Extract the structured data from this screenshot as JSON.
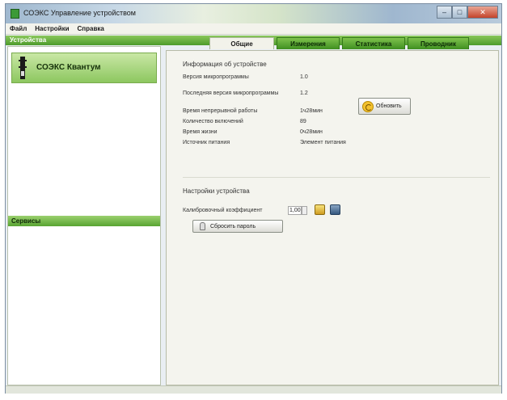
{
  "window": {
    "title": "СОЭКС Управление устройством",
    "controls": {
      "minimize": "–",
      "maximize": "□",
      "close": "✕"
    }
  },
  "menu": [
    "Файл",
    "Настройки",
    "Справка"
  ],
  "sidebar": {
    "devices_header": "Устройства",
    "device_name": "СОЭКС Квантум",
    "services_header": "Сервисы"
  },
  "tabs": [
    {
      "label": "Общие",
      "active": true
    },
    {
      "label": "Измерения",
      "active": false
    },
    {
      "label": "Статистика",
      "active": false
    },
    {
      "label": "Проводник",
      "active": false
    }
  ],
  "device_info": {
    "title": "Информация об устройстве",
    "rows": [
      {
        "label": "Версия микропрограммы",
        "value": "1.0"
      },
      {
        "label": "Последняя версия микропрограммы",
        "value": "1.2"
      },
      {
        "label": "Время непрерывной работы",
        "value": "1ч28мин"
      },
      {
        "label": "Количество включений",
        "value": "89"
      },
      {
        "label": "Время жизни",
        "value": "0ч28мин"
      },
      {
        "label": "Источник питания",
        "value": "Элемент питания"
      }
    ],
    "update_button": "Обновить"
  },
  "device_settings": {
    "title": "Настройки устройства",
    "coef_label": "Калибровочный коэффициент",
    "coef_value": "1,00",
    "reset_button": "Сбросить пароль"
  },
  "colors": {
    "accent_green": "#4d9a2b",
    "tab_green": "#7fc24d",
    "close_red": "#c4432a"
  }
}
